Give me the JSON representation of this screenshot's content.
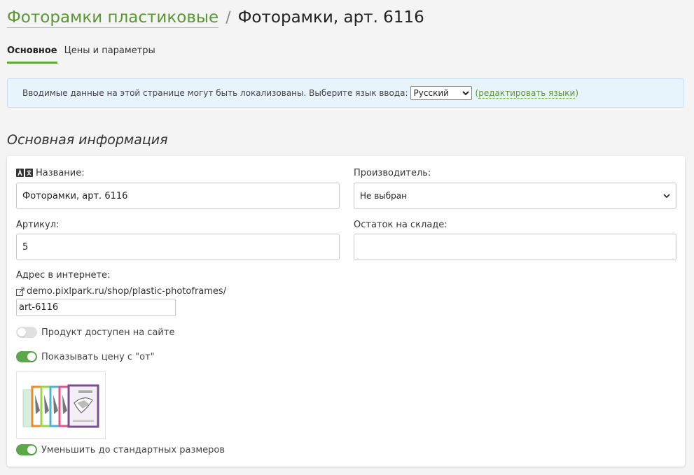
{
  "breadcrumb": {
    "parent": "Фоторамки пластиковые",
    "separator": "/",
    "current": "Фоторамки, арт. 6116"
  },
  "tabs": [
    {
      "label": "Основное",
      "active": true
    },
    {
      "label": "Цены и параметры",
      "active": false
    }
  ],
  "locale_bar": {
    "text": "Вводимые данные на этой странице могут быть локализованы. Выберите язык ввода:",
    "language": "Русский",
    "paren_open": "(",
    "edit_link": "редактировать языки",
    "paren_close": ")"
  },
  "section_title": "Основная информация",
  "form": {
    "name_label": "Название:",
    "name_value": "Фоторамки, арт. 6116",
    "manufacturer_label": "Производитель:",
    "manufacturer_value": "Не выбран",
    "sku_label": "Артикул:",
    "sku_value": "5",
    "stock_label": "Остаток на складе:",
    "stock_value": "",
    "url_label": "Адрес в интернете:",
    "url_base": "demo.pixlpark.ru/shop/plastic-photoframes/",
    "url_slug": "art-6116",
    "available_label": "Продукт доступен на сайте",
    "available_on": false,
    "show_from_price_label": "Показывать цену с \"от\"",
    "show_from_price_on": true,
    "shrink_label": "Уменьшить до стандартных размеров",
    "shrink_on": true
  },
  "icons": {
    "translate": "translate-icon",
    "external_link": "external-link-icon",
    "chevron": "chevron-down-icon"
  },
  "colors": {
    "accent": "#5c9634",
    "toggle_on": "#5aa84a",
    "info_bg": "#e8f4fc"
  }
}
